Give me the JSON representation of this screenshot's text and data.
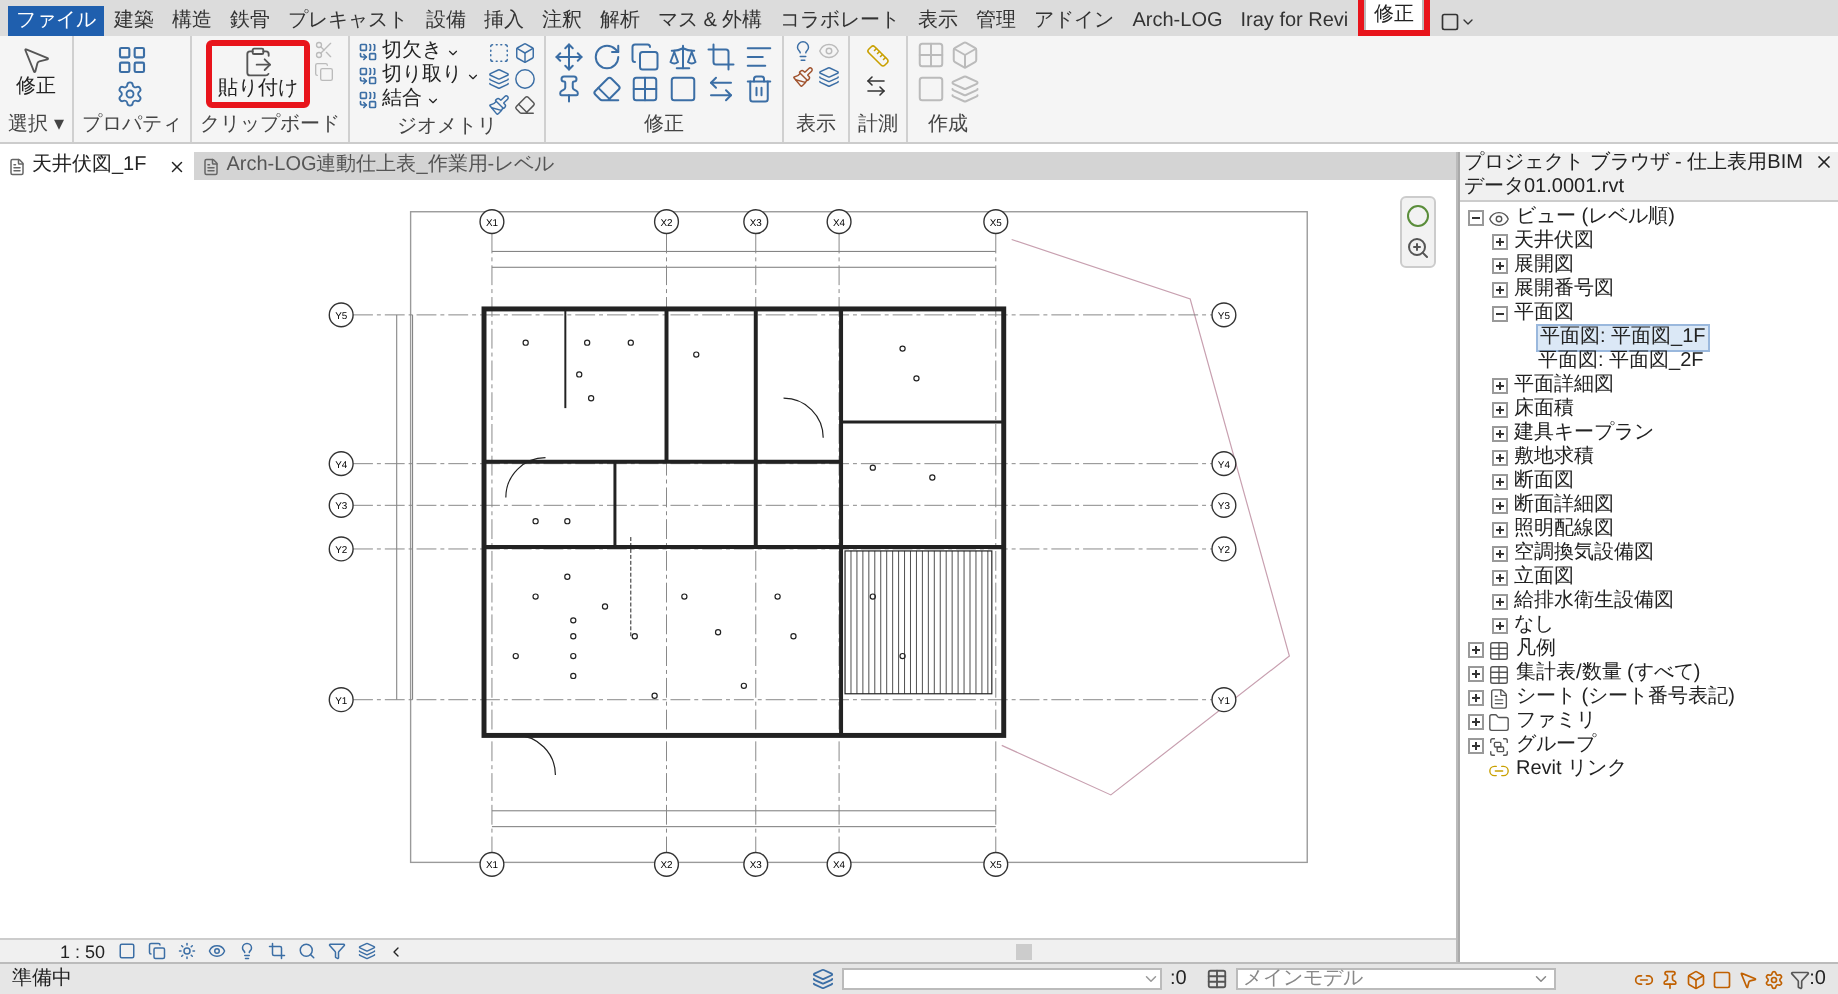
{
  "menu_tabs": [
    {
      "label": "ファイル",
      "kind": "file",
      "selected": false
    },
    {
      "label": "建築",
      "kind": "tab",
      "selected": false
    },
    {
      "label": "構造",
      "kind": "tab",
      "selected": false
    },
    {
      "label": "鉄骨",
      "kind": "tab",
      "selected": false
    },
    {
      "label": "プレキャスト",
      "kind": "tab",
      "selected": false
    },
    {
      "label": "設備",
      "kind": "tab",
      "selected": false
    },
    {
      "label": "挿入",
      "kind": "tab",
      "selected": false
    },
    {
      "label": "注釈",
      "kind": "tab",
      "selected": false
    },
    {
      "label": "解析",
      "kind": "tab",
      "selected": false
    },
    {
      "label": "マス & 外構",
      "kind": "tab",
      "selected": false
    },
    {
      "label": "コラボレート",
      "kind": "tab",
      "selected": false
    },
    {
      "label": "表示",
      "kind": "tab",
      "selected": false
    },
    {
      "label": "管理",
      "kind": "tab",
      "selected": false
    },
    {
      "label": "アドイン",
      "kind": "tab",
      "selected": false
    },
    {
      "label": "Arch-LOG",
      "kind": "tab",
      "selected": false
    },
    {
      "label": "Iray for Revi",
      "kind": "tab",
      "selected": false
    },
    {
      "label": "修正",
      "kind": "tab",
      "selected": true,
      "highlighted": true
    }
  ],
  "ribbon": {
    "select": {
      "button": "修正",
      "panel": "選択 ▾"
    },
    "properties": {
      "panel": "プロパティ"
    },
    "clipboard": {
      "button": "貼り付け",
      "panel": "クリップボード",
      "highlighted": true
    },
    "geometry": {
      "panel": "ジオメトリ",
      "items": [
        "切欠き",
        "切り取り",
        "結合"
      ]
    },
    "modify": {
      "panel": "修正"
    },
    "view": {
      "panel": "表示"
    },
    "measure": {
      "panel": "計測"
    },
    "create": {
      "panel": "作成"
    }
  },
  "view_tabs": [
    {
      "label": "天井伏図_1F",
      "selected": true
    },
    {
      "label": "Arch-LOG連動仕上表_作業用-レベル",
      "selected": false
    }
  ],
  "grid": {
    "x_top": [
      "X1",
      "X2",
      "X3",
      "X4",
      "X5"
    ],
    "x_bottom": [
      "X1",
      "X2",
      "X3",
      "X4",
      "X5"
    ],
    "y_left": [
      "Y5",
      "Y4",
      "Y3",
      "Y2",
      "Y1"
    ],
    "y_right": [
      "Y5",
      "Y4",
      "Y3",
      "Y2",
      "Y1"
    ]
  },
  "project_browser": {
    "title": "プロジェクト ブラウザ - 仕上表用BIMデータ01.0001.rvt",
    "tree": [
      {
        "label": "ビュー (レベル順)",
        "kind": "views",
        "expanded": true,
        "selected": false,
        "children": [
          {
            "label": "天井伏図",
            "expanded": false,
            "selected": false
          },
          {
            "label": "展開図",
            "expanded": false,
            "selected": false
          },
          {
            "label": "展開番号図",
            "expanded": false,
            "selected": false
          },
          {
            "label": "平面図",
            "expanded": true,
            "selected": false,
            "children": [
              {
                "label": "平面図: 平面図_1F",
                "selected": true
              },
              {
                "label": "平面図: 平面図_2F",
                "selected": false
              }
            ]
          },
          {
            "label": "平面詳細図",
            "expanded": false,
            "selected": false
          },
          {
            "label": "床面積",
            "expanded": false,
            "selected": false
          },
          {
            "label": "建具キープラン",
            "expanded": false,
            "selected": false
          },
          {
            "label": "敷地求積",
            "expanded": false,
            "selected": false
          },
          {
            "label": "断面図",
            "expanded": false,
            "selected": false
          },
          {
            "label": "断面詳細図",
            "expanded": false,
            "selected": false
          },
          {
            "label": "照明配線図",
            "expanded": false,
            "selected": false
          },
          {
            "label": "空調換気設備図",
            "expanded": false,
            "selected": false
          },
          {
            "label": "立面図",
            "expanded": false,
            "selected": false
          },
          {
            "label": "給排水衛生設備図",
            "expanded": false,
            "selected": false
          },
          {
            "label": "なし",
            "expanded": false,
            "selected": false
          }
        ]
      },
      {
        "label": "凡例",
        "kind": "legend",
        "expanded": false,
        "selected": false
      },
      {
        "label": "集計表/数量 (すべて)",
        "kind": "schedule",
        "expanded": false,
        "selected": false
      },
      {
        "label": "シート (シート番号表記)",
        "kind": "sheet",
        "expanded": false,
        "selected": false
      },
      {
        "label": "ファミリ",
        "kind": "family",
        "expanded": false,
        "selected": false
      },
      {
        "label": "グループ",
        "kind": "group",
        "expanded": false,
        "selected": false
      },
      {
        "label": "Revit リンク",
        "kind": "link",
        "selected": false
      }
    ]
  },
  "view_bar": {
    "scale": "1 : 50"
  },
  "status_bar": {
    "message": "準備中",
    "count": ":0",
    "workset": "メインモデル",
    "filter_count": ":0"
  }
}
